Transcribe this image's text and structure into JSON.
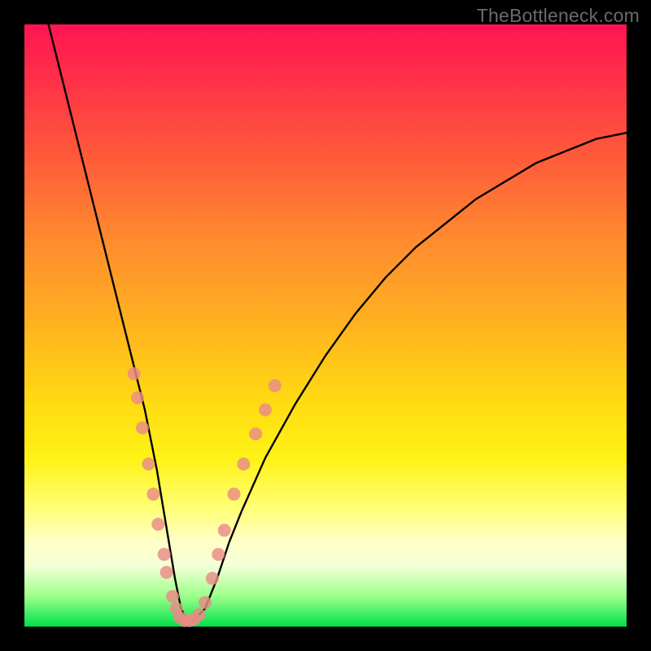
{
  "watermark": "TheBottleneck.com",
  "chart_data": {
    "type": "line",
    "title": "",
    "xlabel": "",
    "ylabel": "",
    "xlim": [
      0,
      100
    ],
    "ylim": [
      0,
      100
    ],
    "grid": false,
    "legend": false,
    "series": [
      {
        "name": "bottleneck-curve",
        "x": [
          4,
          6,
          8,
          10,
          12,
          14,
          16,
          18,
          20,
          22,
          24,
          25,
          26,
          27,
          28,
          30,
          32,
          34,
          36,
          40,
          45,
          50,
          55,
          60,
          65,
          70,
          75,
          80,
          85,
          90,
          95,
          100
        ],
        "y": [
          100,
          92,
          84,
          76,
          68,
          60,
          52,
          44,
          36,
          26,
          14,
          8,
          3,
          1,
          1,
          3,
          8,
          14,
          19,
          28,
          37,
          45,
          52,
          58,
          63,
          67,
          71,
          74,
          77,
          79,
          81,
          82
        ]
      }
    ],
    "markers": {
      "name": "highlight-dots",
      "color": "#e98b86",
      "radius_px": 8,
      "points": [
        {
          "x": 18.2,
          "y": 42
        },
        {
          "x": 18.8,
          "y": 38
        },
        {
          "x": 19.6,
          "y": 33
        },
        {
          "x": 20.6,
          "y": 27
        },
        {
          "x": 21.4,
          "y": 22
        },
        {
          "x": 22.2,
          "y": 17
        },
        {
          "x": 23.2,
          "y": 12
        },
        {
          "x": 23.6,
          "y": 9
        },
        {
          "x": 24.6,
          "y": 5
        },
        {
          "x": 25.2,
          "y": 3
        },
        {
          "x": 25.8,
          "y": 1.5
        },
        {
          "x": 26.6,
          "y": 1
        },
        {
          "x": 27.4,
          "y": 1
        },
        {
          "x": 28.2,
          "y": 1.2
        },
        {
          "x": 29.0,
          "y": 2
        },
        {
          "x": 30.0,
          "y": 4
        },
        {
          "x": 31.2,
          "y": 8
        },
        {
          "x": 32.2,
          "y": 12
        },
        {
          "x": 33.2,
          "y": 16
        },
        {
          "x": 34.8,
          "y": 22
        },
        {
          "x": 36.4,
          "y": 27
        },
        {
          "x": 38.4,
          "y": 32
        },
        {
          "x": 40.0,
          "y": 36
        },
        {
          "x": 41.6,
          "y": 40
        }
      ]
    },
    "gradient_stops": [
      {
        "pos": 0,
        "color": "#ff1452"
      },
      {
        "pos": 50,
        "color": "#ffb31f"
      },
      {
        "pos": 80,
        "color": "#ffff72"
      },
      {
        "pos": 100,
        "color": "#00e04a"
      }
    ]
  }
}
